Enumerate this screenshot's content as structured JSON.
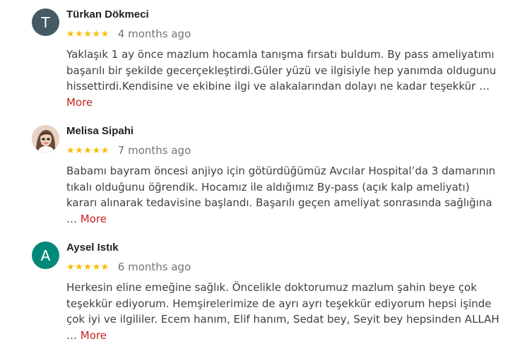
{
  "reviews": [
    {
      "avatar_letter": "T",
      "avatar_color": "#455a64",
      "name": "Türkan Dökmeci",
      "stars": "★★★★★",
      "rating": 5,
      "date": "4 months ago",
      "lines": [
        "Yaklaşık 1 ay önce mazlum hocamla tanışma fırsatı buldum. By pass ameliyatımı",
        "başarılı bir şekilde gecerçekleştirdi.Güler yüzü ve ilgisiyle hep yanımda oldugunu",
        "hissettirdi.Kendisine ve ekibine ilgi ve alakalarından dolayı ne kadar teşekkür …"
      ],
      "more_label": "More"
    },
    {
      "avatar_color": "#d9b9a6",
      "name": "Melisa Sipahi",
      "stars": "★★★★★",
      "rating": 5,
      "date": "7 months ago",
      "lines": [
        "Babamı bayram öncesi anjiyo için götürdüğümüz Avcılar Hospital’da 3 damarının",
        "tıkalı olduğunu öğrendik. Hocamız ile aldığımız By-pass (açık kalp ameliyatı)",
        "kararı alınarak tedavisine başlandı. Başarılı geçen ameliyat sonrasında sağlığına"
      ],
      "ellipsis": "…",
      "more_label": "More"
    },
    {
      "avatar_letter": "A",
      "avatar_color": "#00897b",
      "name": "Aysel Istık",
      "stars": "★★★★★",
      "rating": 5,
      "date": "6 months ago",
      "lines": [
        "Herkesin eline emeğine sağlık. Öncelikle doktorumuz mazlum şahin beye çok",
        "teşekkür ediyorum. Hemşirelerimize de ayrı ayrı teşekkür ediyorum hepsi işinde",
        "çok iyi ve ilgililer. Ecem hanım, Elif hanım, Sedat bey, Seyit bey hepsinden ALLAH"
      ],
      "ellipsis": "…",
      "more_label": "More"
    }
  ]
}
